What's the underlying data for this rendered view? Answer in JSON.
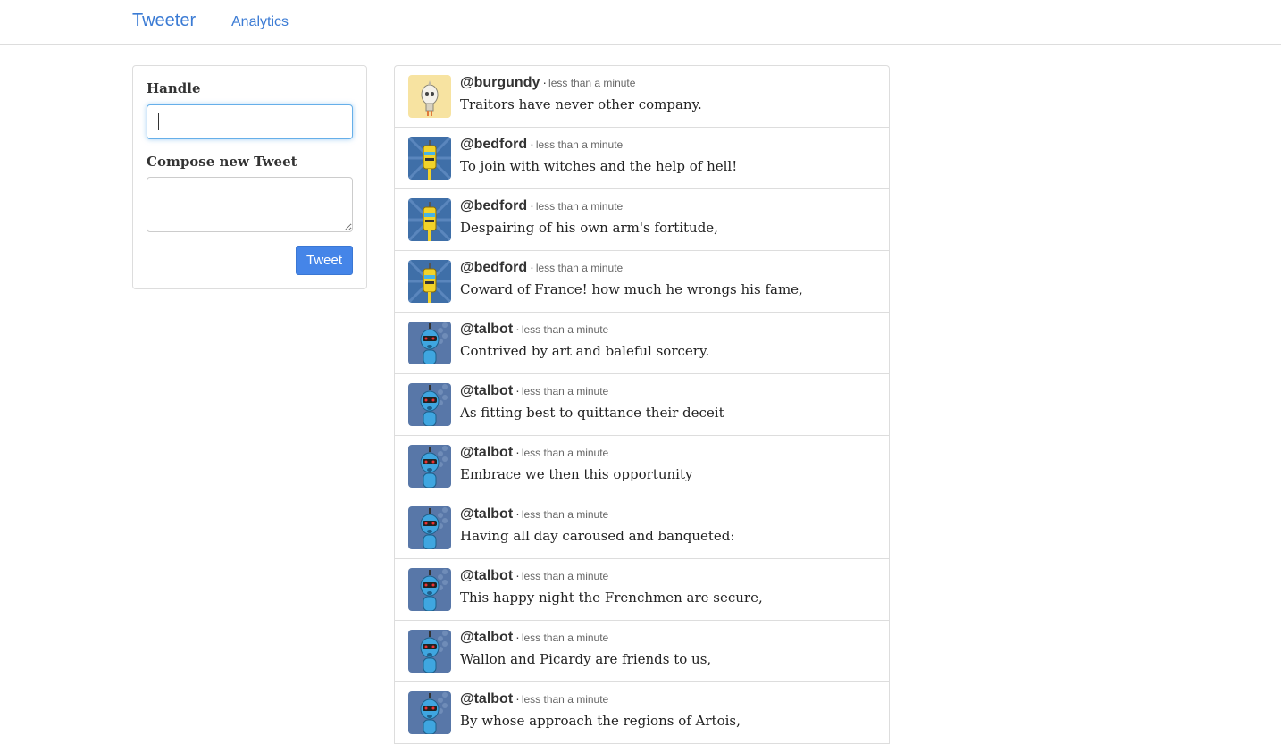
{
  "nav": {
    "brand": "Tweeter",
    "analytics": "Analytics"
  },
  "compose": {
    "handle_label": "Handle",
    "handle_value": "",
    "compose_label": "Compose new Tweet",
    "compose_value": "",
    "tweet_button": "Tweet"
  },
  "colors": {
    "brand": "#3b7bd4",
    "button": "#4585e8",
    "burgundy_avatar_bg": "#f7e3a1",
    "bedford_avatar_bg": "#3f6fa8",
    "talbot_avatar_bg": "#5877a8"
  },
  "tweets": [
    {
      "handle": "@burgundy",
      "avatar": "burgundy-avatar-icon",
      "sep": "·",
      "time": "less than a minute",
      "text": "Traitors have never other company."
    },
    {
      "handle": "@bedford",
      "avatar": "bedford-avatar-icon",
      "sep": "·",
      "time": "less than a minute",
      "text": "To join with witches and the help of hell!"
    },
    {
      "handle": "@bedford",
      "avatar": "bedford-avatar-icon",
      "sep": "·",
      "time": "less than a minute",
      "text": "Despairing of his own arm's fortitude,"
    },
    {
      "handle": "@bedford",
      "avatar": "bedford-avatar-icon",
      "sep": "·",
      "time": "less than a minute",
      "text": "Coward of France! how much he wrongs his fame,"
    },
    {
      "handle": "@talbot",
      "avatar": "talbot-avatar-icon",
      "sep": "·",
      "time": "less than a minute",
      "text": "Contrived by art and baleful sorcery."
    },
    {
      "handle": "@talbot",
      "avatar": "talbot-avatar-icon",
      "sep": "·",
      "time": "less than a minute",
      "text": "As fitting best to quittance their deceit"
    },
    {
      "handle": "@talbot",
      "avatar": "talbot-avatar-icon",
      "sep": "·",
      "time": "less than a minute",
      "text": "Embrace we then this opportunity"
    },
    {
      "handle": "@talbot",
      "avatar": "talbot-avatar-icon",
      "sep": "·",
      "time": "less than a minute",
      "text": "Having all day caroused and banqueted:"
    },
    {
      "handle": "@talbot",
      "avatar": "talbot-avatar-icon",
      "sep": "·",
      "time": "less than a minute",
      "text": "This happy night the Frenchmen are secure,"
    },
    {
      "handle": "@talbot",
      "avatar": "talbot-avatar-icon",
      "sep": "·",
      "time": "less than a minute",
      "text": "Wallon and Picardy are friends to us,"
    },
    {
      "handle": "@talbot",
      "avatar": "talbot-avatar-icon",
      "sep": "·",
      "time": "less than a minute",
      "text": "By whose approach the regions of Artois,"
    }
  ]
}
